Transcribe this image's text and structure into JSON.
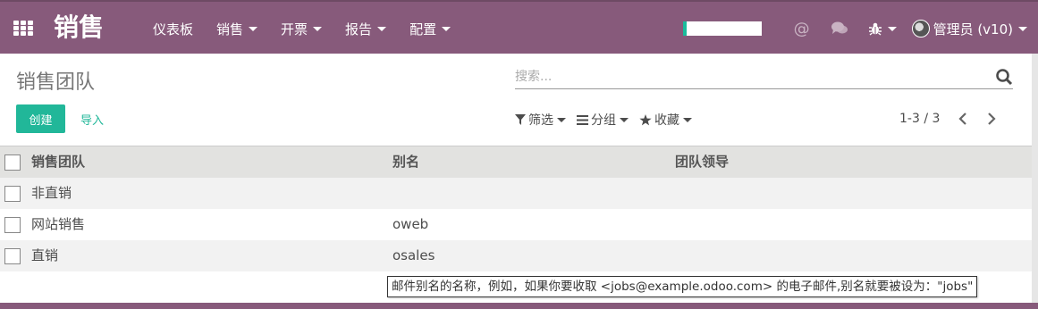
{
  "app": {
    "title": "销售"
  },
  "nav": {
    "items": [
      {
        "label": "仪表板",
        "dropdown": false
      },
      {
        "label": "销售",
        "dropdown": true
      },
      {
        "label": "开票",
        "dropdown": true
      },
      {
        "label": "报告",
        "dropdown": true
      },
      {
        "label": "配置",
        "dropdown": true
      }
    ]
  },
  "systray": {
    "progress": 0.05,
    "at_icon": "@",
    "user_label": "管理员 (v10)"
  },
  "page": {
    "breadcrumb": "销售团队"
  },
  "search": {
    "placeholder": "搜索..."
  },
  "buttons": {
    "create": "创建",
    "import": "导入"
  },
  "search_options": {
    "filters": "筛选",
    "group_by": "分组",
    "favorites": "收藏"
  },
  "pager": {
    "value": "1-3 / 3"
  },
  "table": {
    "columns": [
      "销售团队",
      "别名",
      "团队领导"
    ],
    "rows": [
      {
        "team": "非直销",
        "alias": "",
        "leader": ""
      },
      {
        "team": "网站销售",
        "alias": "oweb",
        "leader": ""
      },
      {
        "team": "直销",
        "alias": "osales",
        "leader": ""
      }
    ]
  },
  "tooltip": {
    "text": "邮件别名的名称，例如，如果你要收取 <jobs@example.odoo.com> 的电子邮件,别名就要被设为：\"jobs\""
  },
  "colors": {
    "brand": "#875A7B",
    "accent": "#21b799"
  }
}
